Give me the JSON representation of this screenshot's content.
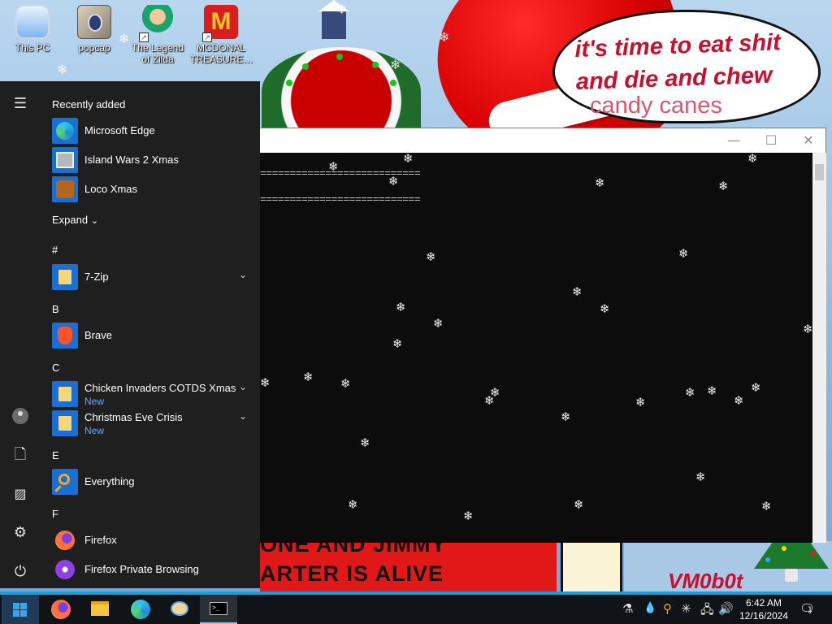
{
  "desktop": {
    "icons": [
      {
        "label": "This PC",
        "icon": "computer-icon"
      },
      {
        "label": "popcap",
        "icon": "folder-icon"
      },
      {
        "label": "The Legend of Zilda",
        "icon": "game-icon"
      },
      {
        "label": "MCDONAL TREASURE…",
        "icon": "game-icon"
      }
    ],
    "bubble_line_1": "it's time to eat shit",
    "bubble_line_2": "and die and chew",
    "bubble_line_3": "candy canes",
    "wall_line_1": "ONE AND JIMMY",
    "wall_line_2": "ARTER IS ALIVE",
    "wall_corner_text": "VM0b0t"
  },
  "console": {
    "lines": [
      "===========================",
      "==========================="
    ],
    "buttons": {
      "minimize": "—",
      "maximize": "☐",
      "close": "✕"
    }
  },
  "start_menu": {
    "recently_added_label": "Recently added",
    "recent": [
      {
        "name": "Microsoft Edge",
        "icon": "edge-icon"
      },
      {
        "name": "Island Wars 2 Xmas",
        "icon": "game-icon"
      },
      {
        "name": "Loco Xmas",
        "icon": "game-icon"
      }
    ],
    "expand_label": "Expand",
    "sections": [
      {
        "letter": "#",
        "apps": [
          {
            "name": "7-Zip",
            "icon": "folder-icon",
            "badge": "",
            "expandable": true
          }
        ]
      },
      {
        "letter": "B",
        "apps": [
          {
            "name": "Brave",
            "icon": "brave-icon",
            "badge": "",
            "expandable": false
          }
        ]
      },
      {
        "letter": "C",
        "apps": [
          {
            "name": "Chicken Invaders COTDS Xmas",
            "icon": "folder-icon",
            "badge": "New",
            "expandable": true
          },
          {
            "name": "Christmas Eve Crisis",
            "icon": "folder-icon",
            "badge": "New",
            "expandable": true
          }
        ]
      },
      {
        "letter": "E",
        "apps": [
          {
            "name": "Everything",
            "icon": "search-icon",
            "badge": "",
            "expandable": false
          }
        ]
      },
      {
        "letter": "F",
        "apps": [
          {
            "name": "Firefox",
            "icon": "firefox-icon",
            "badge": "",
            "expandable": false
          },
          {
            "name": "Firefox Private Browsing",
            "icon": "firefox-private-icon",
            "badge": "",
            "expandable": false
          }
        ]
      }
    ]
  },
  "taskbar": {
    "pinned": [
      "start-icon",
      "firefox-icon",
      "file-explorer-icon",
      "edge-icon",
      "network-icon",
      "terminal-icon"
    ],
    "clock_time": "6:42 AM",
    "clock_date": "12/16/2024",
    "notification_count": "1"
  },
  "colors": {
    "accent": "#1f9bd9",
    "new_badge": "#6aa8ff",
    "menu_bg": "#1f1f1f"
  }
}
